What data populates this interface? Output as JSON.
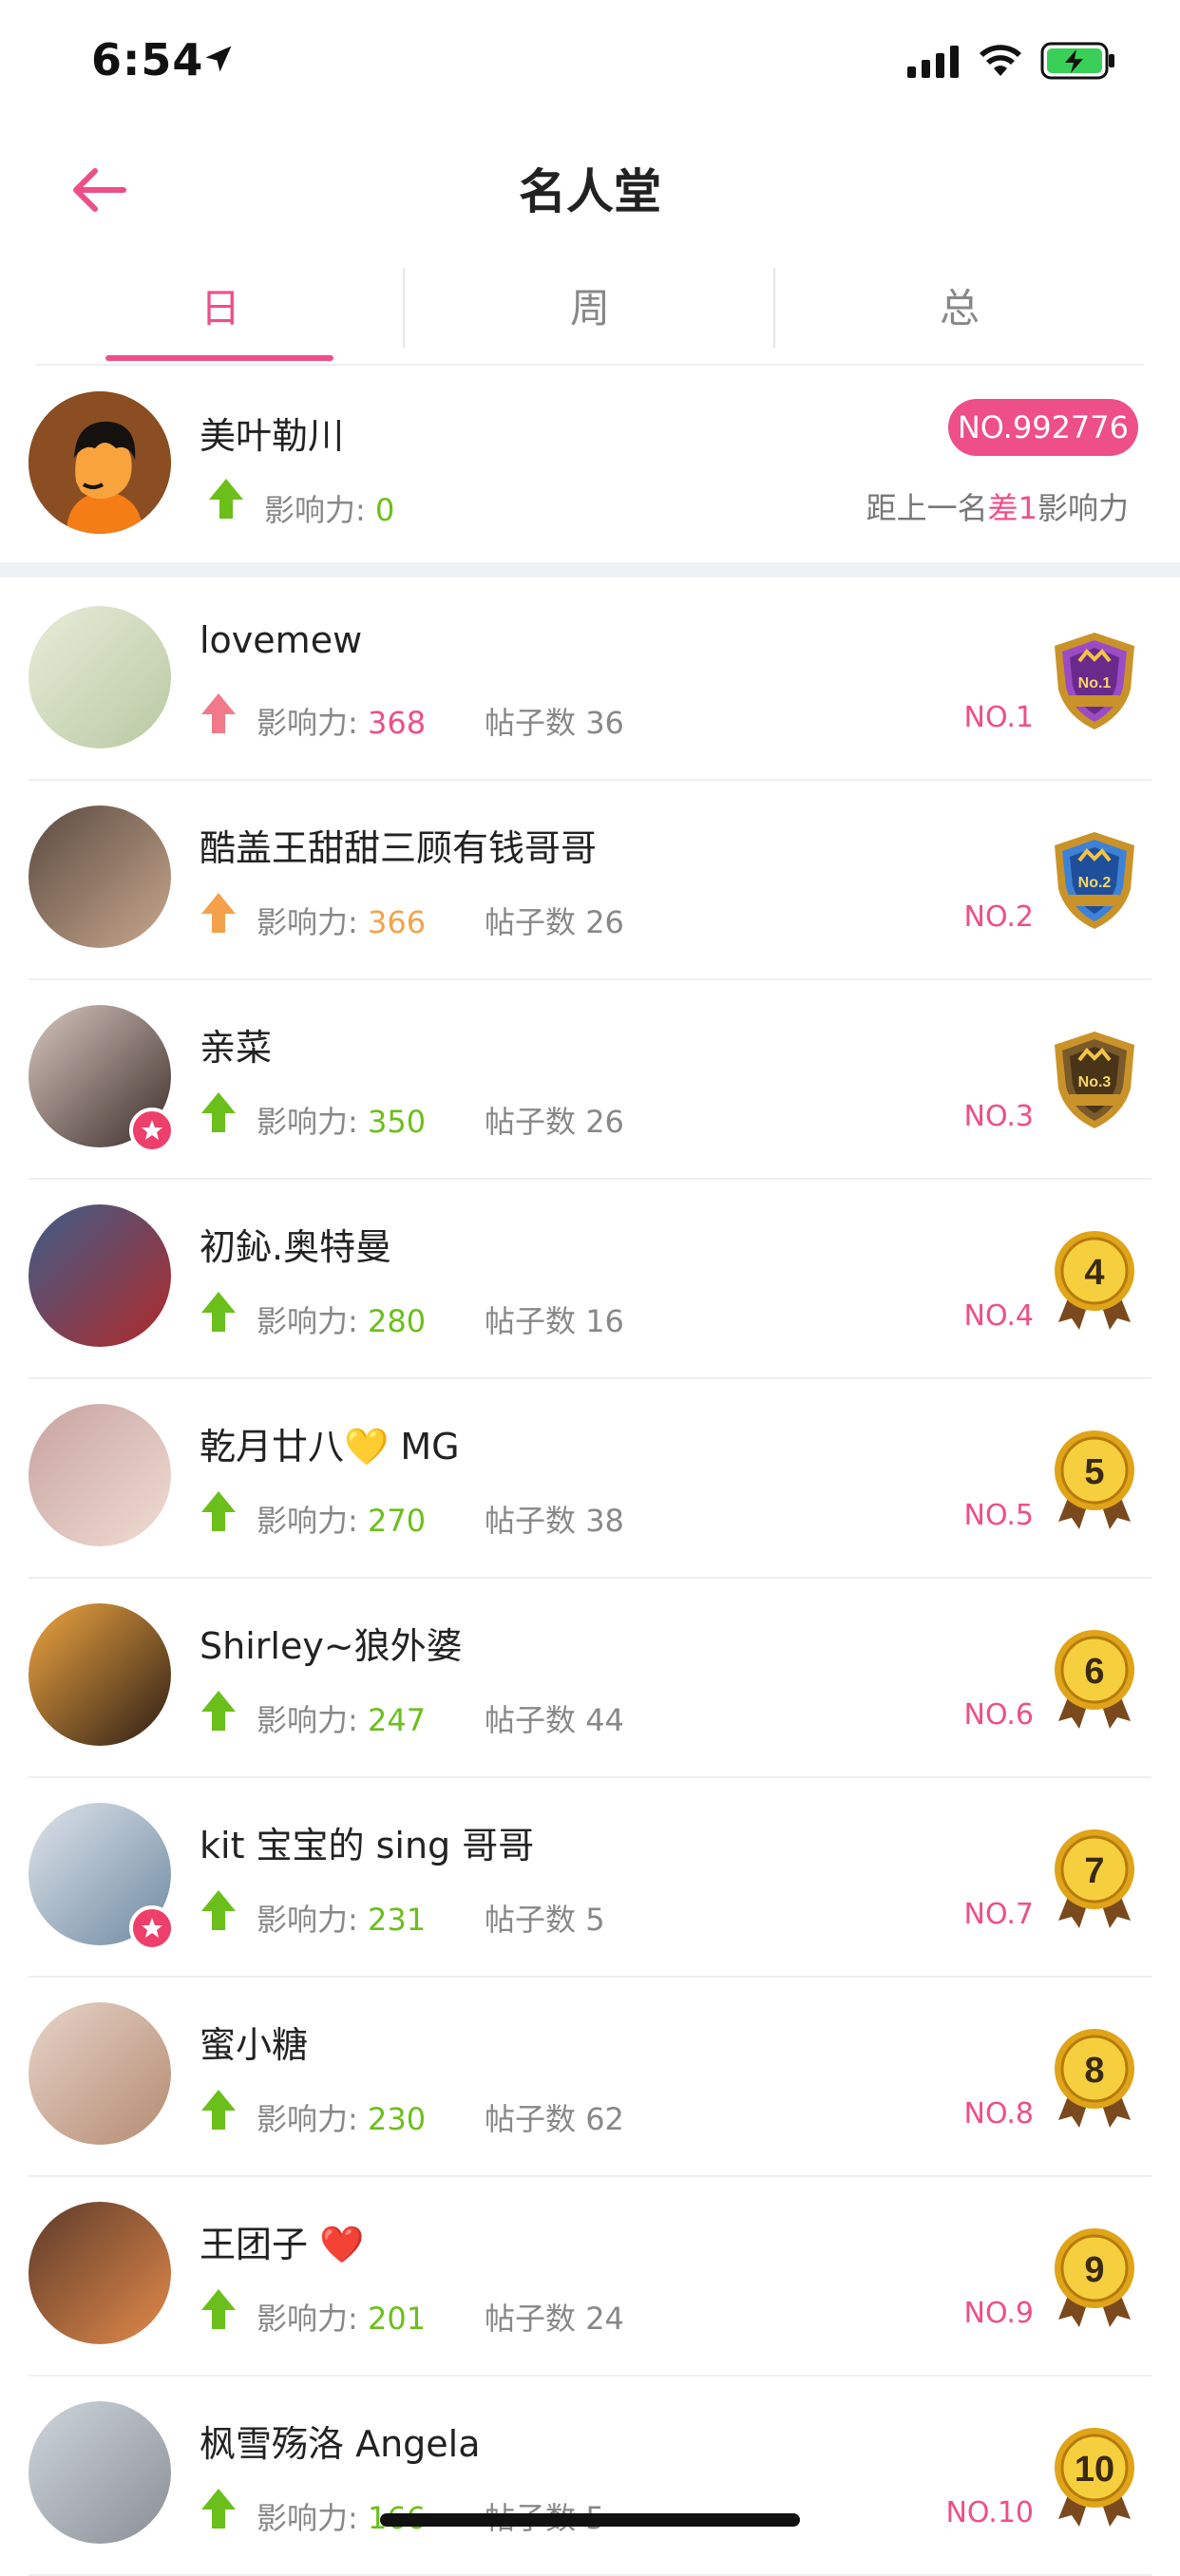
{
  "status_bar": {
    "time": "6:54"
  },
  "nav": {
    "title": "名人堂"
  },
  "tabs": [
    {
      "label": "日",
      "active": true
    },
    {
      "label": "周",
      "active": false
    },
    {
      "label": "总",
      "active": false
    }
  ],
  "me": {
    "name": "美叶勒川",
    "influence_label": "影响力: ",
    "influence_value": "0",
    "rank_badge": "NO.992776",
    "gap_prefix": "距上一名",
    "gap_highlight": "差1",
    "gap_suffix": "影响力"
  },
  "labels": {
    "influence": "影响力: ",
    "posts": "帖子数 "
  },
  "colors": {
    "accent": "#ee4f88",
    "green": "#6bbf1a",
    "orange": "#f3a24b",
    "red_arrow": "#f07a8a",
    "gray": "#888888"
  },
  "entries": [
    {
      "name": "lovemew",
      "influence": "368",
      "posts": "36",
      "rank": "NO.1",
      "medal_text": "No.1",
      "value_color": "#ee4f88",
      "arrow_color": "#f07a8a",
      "medal": "purple-shield"
    },
    {
      "name": "酷盖王甜甜三顾有钱哥哥",
      "influence": "366",
      "posts": "26",
      "rank": "NO.2",
      "medal_text": "No.2",
      "value_color": "#f3a24b",
      "arrow_color": "#f3a24b",
      "medal": "blue-shield"
    },
    {
      "name": "亲菜",
      "influence": "350",
      "posts": "26",
      "rank": "NO.3",
      "medal_text": "No.3",
      "value_color": "#6bbf1a",
      "arrow_color": "#6bbf1a",
      "medal": "bronze-shield",
      "verified": true
    },
    {
      "name": "初鈊.奥特曼",
      "influence": "280",
      "posts": "16",
      "rank": "NO.4",
      "medal_text": "4",
      "value_color": "#6bbf1a",
      "arrow_color": "#6bbf1a",
      "medal": "gold-rosette"
    },
    {
      "name": "乾月廿八💛 MG",
      "influence": "270",
      "posts": "38",
      "rank": "NO.5",
      "medal_text": "5",
      "value_color": "#6bbf1a",
      "arrow_color": "#6bbf1a",
      "medal": "gold-rosette"
    },
    {
      "name": "Shirley~狼外婆",
      "influence": "247",
      "posts": "44",
      "rank": "NO.6",
      "medal_text": "6",
      "value_color": "#6bbf1a",
      "arrow_color": "#6bbf1a",
      "medal": "gold-rosette"
    },
    {
      "name": "kit 宝宝的 sing 哥哥",
      "influence": "231",
      "posts": "5",
      "rank": "NO.7",
      "medal_text": "7",
      "value_color": "#6bbf1a",
      "arrow_color": "#6bbf1a",
      "medal": "gold-rosette",
      "verified": true
    },
    {
      "name": "蜜小糖",
      "influence": "230",
      "posts": "62",
      "rank": "NO.8",
      "medal_text": "8",
      "value_color": "#6bbf1a",
      "arrow_color": "#6bbf1a",
      "medal": "gold-rosette"
    },
    {
      "name": "王团子 ❤️",
      "influence": "201",
      "posts": "24",
      "rank": "NO.9",
      "medal_text": "9",
      "value_color": "#6bbf1a",
      "arrow_color": "#6bbf1a",
      "medal": "gold-rosette"
    },
    {
      "name": "枫雪殇洛 Angela",
      "influence": "166",
      "posts": "5",
      "rank": "NO.10",
      "medal_text": "10",
      "value_color": "#6bbf1a",
      "arrow_color": "#6bbf1a",
      "medal": "gold-rosette"
    }
  ]
}
